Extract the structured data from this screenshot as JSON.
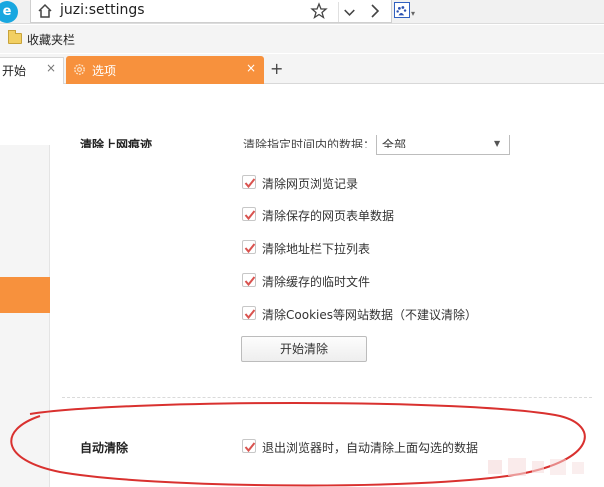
{
  "browser": {
    "address": "juzi:settings"
  },
  "bookmarks_bar": {
    "items": [
      {
        "label": "收藏夹栏",
        "icon": "folder-icon"
      }
    ]
  },
  "tabs": [
    {
      "label": "开始",
      "close": "×",
      "active": false
    },
    {
      "label": "选项",
      "close": "×",
      "active": true,
      "icon": "gear-icon"
    }
  ],
  "new_tab": "+",
  "clear_history_section": {
    "title": "清除上网痕迹",
    "time_range_label": "清除指定时间内的数据：",
    "time_range_value": "全部",
    "options": [
      {
        "label": "清除网页浏览记录",
        "checked": true
      },
      {
        "label": "清除保存的网页表单数据",
        "checked": true
      },
      {
        "label": "清除地址栏下拉列表",
        "checked": true
      },
      {
        "label": "清除缓存的临时文件",
        "checked": true
      },
      {
        "label": "清除Cookies等网站数据（不建议清除）",
        "checked": true
      }
    ],
    "clear_button": "开始清除"
  },
  "auto_clear_section": {
    "title": "自动清除",
    "option": {
      "label": "退出浏览器时，自动清除上面勾选的数据",
      "checked": true
    }
  },
  "colors": {
    "accent": "#f7913d",
    "checkmark": "#d9534f",
    "annotation_ellipse": "#d9312f"
  }
}
